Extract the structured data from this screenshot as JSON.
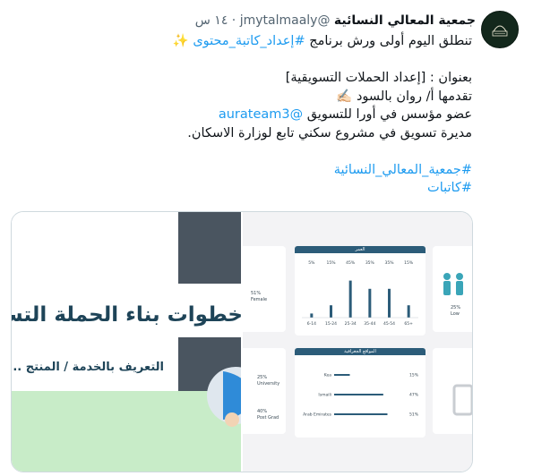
{
  "tweet": {
    "author_name": "جمعية المعالي النسائية",
    "handle": "@jmytalmaaly",
    "time": "١٤ س",
    "separator": "·",
    "lines": [
      {
        "text": "تنطلق اليوم أولى ورش برنامج ",
        "link": "#إعداد_كاتبة_محتوى",
        "suffix": " ✨"
      },
      {
        "gap": true
      },
      {
        "text": "بعنوان : [إعداد الحملات التسويقية]"
      },
      {
        "text": "تقدمها  أ/ روان بالسود ✍🏻"
      },
      {
        "text": "عضو مؤسس في أورا للتسويق ",
        "link": "@aurateam3"
      },
      {
        "text": "مديرة تسويق في مشروع سكني تابع لوزارة الاسكان."
      },
      {
        "gap": true
      },
      {
        "link": "#جمعية_المعالي_النسائية"
      },
      {
        "link": "#كاتبات"
      }
    ]
  },
  "media": {
    "left_slide": {
      "title": "خطوات بناء الحملة التسويقية",
      "bullet": "التعريف بالخدمة / المنتج ...",
      "bullet_marker": "•"
    },
    "right_slide": {
      "age_card": {
        "header": "العمر",
        "labels": [
          "6-14",
          "15-24",
          "25-34",
          "35-44",
          "45-54",
          "65+"
        ],
        "percents": [
          "5%",
          "15%",
          "45%",
          "35%",
          "35%",
          "15%"
        ],
        "values": [
          5,
          15,
          45,
          35,
          35,
          15
        ]
      },
      "geo_card": {
        "header": "المواقع الجغرافية",
        "labels": [
          "Kea",
          "Ismaili",
          "Arab Emirates"
        ],
        "percents": [
          "15%",
          "47%",
          "51%"
        ],
        "values": [
          15,
          47,
          51
        ]
      },
      "side_stats": [
        {
          "pct": "51%",
          "label": "Female"
        },
        {
          "pct": "25%",
          "label": "University"
        },
        {
          "pct": "40%",
          "label": "Post Grad"
        },
        {
          "pct": "25%",
          "label": "Low"
        }
      ]
    }
  }
}
